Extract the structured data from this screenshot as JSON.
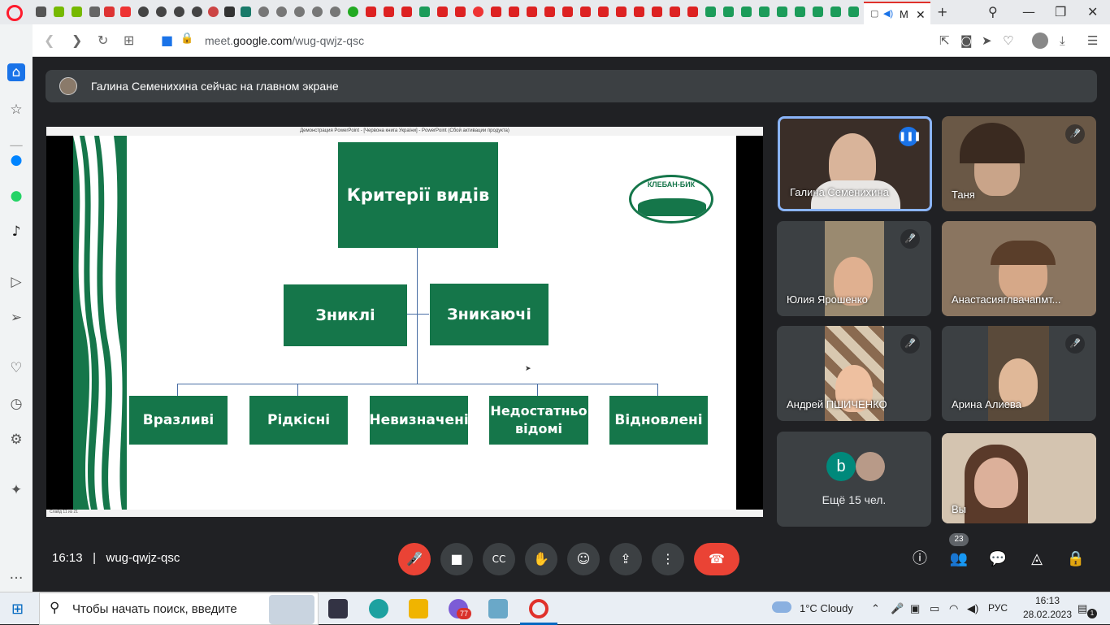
{
  "browser": {
    "active_tab_label": "M",
    "url_prefix": "meet.",
    "url_domain": "google.com",
    "url_path": "/wug-qwjz-qsc"
  },
  "banner": {
    "text": "Галина Семенихина сейчас на главном экране"
  },
  "ppt": {
    "titlebar": "Демонстрация PowerPoint - [Червона книга України] - PowerPoint (Сбой активации продукта)",
    "status": "Слайд 11 из 21"
  },
  "slide": {
    "top": "Критерії видів",
    "mid": [
      "Зниклі",
      "Зникаючі"
    ],
    "bottom": [
      "Вразливі",
      "Рідкісні",
      "Невизначені",
      "Недостатньо відомі",
      "Відновлені"
    ],
    "logo_text": "КЛЕБАН-БИК"
  },
  "participants": [
    {
      "name": "Галина Семенихина",
      "mic": "speaking"
    },
    {
      "name": "Таня",
      "mic": "muted"
    },
    {
      "name": "Юлия Ярошенко",
      "mic": "muted"
    },
    {
      "name": "Анастасияглвачапмт...",
      "mic": "muted"
    },
    {
      "name": "Андрей ПШИЧЕНКО",
      "mic": "muted"
    },
    {
      "name": "Арина Алиева",
      "mic": "muted"
    }
  ],
  "others": {
    "avatar_letter": "b",
    "label": "Ещё 15 чел."
  },
  "self": {
    "name": "Вы"
  },
  "meeting": {
    "time": "16:13",
    "separator": "|",
    "code": "wug-qwjz-qsc",
    "people_count": "23"
  },
  "taskbar": {
    "search_placeholder": "Чтобы начать поиск, введите",
    "opera_badge": "77",
    "weather": "1°C  Cloudy",
    "lang": "РУС",
    "clock_time": "16:13",
    "clock_date": "28.02.2023",
    "notif": "1"
  },
  "colors": {
    "slide_green": "#15764a",
    "meet_bg": "#202124",
    "end_call": "#ea4335",
    "active_tile": "#8ab4f8"
  }
}
